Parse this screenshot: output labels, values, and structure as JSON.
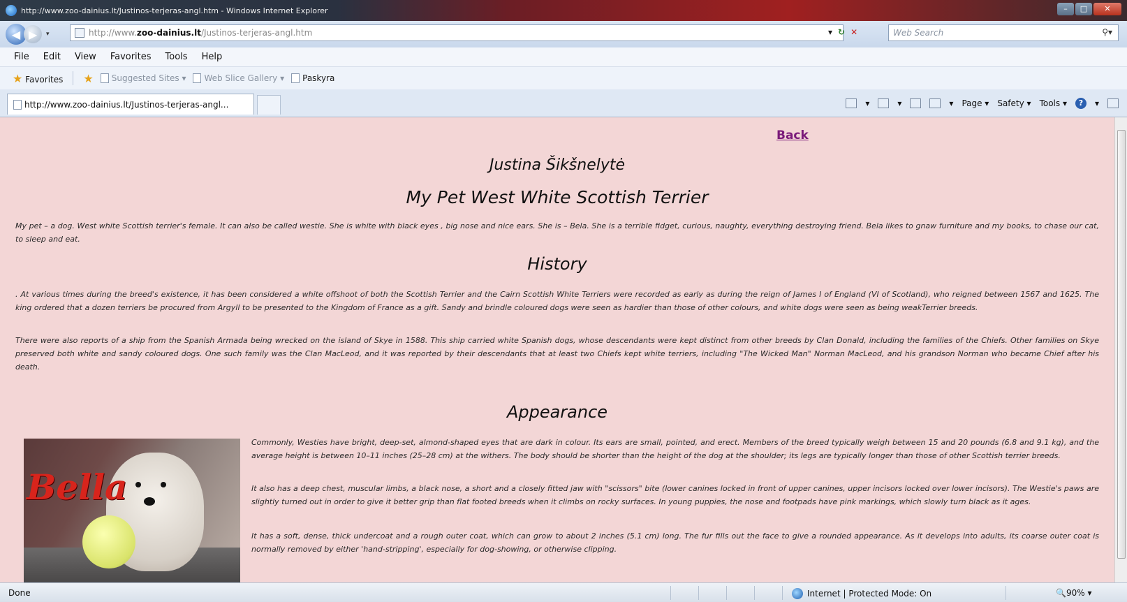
{
  "window": {
    "title": "http://www.zoo-dainius.lt/Justinos-terjeras-angl.htm - Windows Internet Explorer"
  },
  "address_bar": {
    "url_prefix": "http://www.",
    "url_domain": "zoo-dainius.lt",
    "url_path": "/Justinos-terjeras-angl.htm",
    "search_placeholder": "Web Search"
  },
  "menu": [
    "File",
    "Edit",
    "View",
    "Favorites",
    "Tools",
    "Help"
  ],
  "favorites_bar": {
    "favorites_label": "Favorites",
    "suggested_sites": "Suggested Sites ▾",
    "web_slice_gallery": "Web Slice Gallery ▾",
    "paskyra": "Paskyra"
  },
  "tab": {
    "label": "http://www.zoo-dainius.lt/Justinos-terjeras-angl..."
  },
  "command_bar": {
    "page": "Page ▾",
    "safety": "Safety ▾",
    "tools": "Tools ▾"
  },
  "content": {
    "back_link": "Back",
    "author": "Justina Šikšnelytė",
    "title": "My Pet West White Scottish Terrier",
    "intro": "My pet – a dog. West white Scottish terrier's female. It can also be called westie. She is white with black eyes , big nose and nice ears. She is – Bela. She is a terrible fidget, curious, naughty, everything destroying friend. Bela likes to gnaw furniture and my books, to chase our cat, to sleep and eat.",
    "history_heading": "History",
    "history_p1": ". At various times during the breed's existence, it has been considered a white offshoot of both the Scottish Terrier and the Cairn Scottish White Terriers were recorded as early as during the reign of James I of England (VI of Scotland), who reigned between 1567 and 1625. The king ordered that a dozen terriers be procured from Argyll to be presented to the Kingdom of France as a gift. Sandy and brindle coloured dogs were seen as hardier than those of other colours, and white dogs were seen as being weakTerrier breeds.",
    "history_p2": "There were also reports of a ship from the Spanish Armada being wrecked on the island of Skye in 1588. This ship carried white Spanish dogs, whose descendants were kept distinct from other breeds by Clan Donald, including the families of the Chiefs. Other families on Skye preserved both white and sandy coloured dogs. One such family was the Clan MacLeod, and it was reported by their descendants that at least two Chiefs kept white terriers, including \"The Wicked Man\" Norman MacLeod, and his grandson Norman who became Chief after his death.",
    "appearance_heading": "Appearance",
    "photo_caption_text": "Bella",
    "appearance_p1": "Commonly, Westies have bright, deep-set, almond-shaped eyes that are dark in colour. Its ears are small, pointed, and erect. Members of the breed typically weigh between 15 and 20 pounds (6.8 and 9.1 kg), and the average height is between 10–11 inches (25–28 cm) at the withers. The body should be shorter than the height of the dog at the shoulder; its legs are typically longer than those of other Scottish terrier breeds.",
    "appearance_p2": "It also has a deep chest, muscular limbs, a black nose, a short and a closely fitted jaw with \"scissors\" bite (lower canines locked in front of upper canines, upper incisors locked over lower incisors). The Westie's paws are slightly turned out in order to give it better grip than flat footed breeds when it climbs on rocky surfaces. In young puppies, the nose and footpads have pink markings, which slowly turn black as it ages.",
    "appearance_p3": "It has a soft, dense, thick undercoat and a rough outer coat, which can grow to about 2 inches (5.1 cm) long. The fur fills out the face to give a rounded appearance. As it develops into adults, its coarse outer coat is normally removed by either 'hand-stripping', especially for dog-showing, or otherwise clipping."
  },
  "status_bar": {
    "status": "Done",
    "zone": "Internet | Protected Mode: On",
    "zoom": "90%"
  }
}
